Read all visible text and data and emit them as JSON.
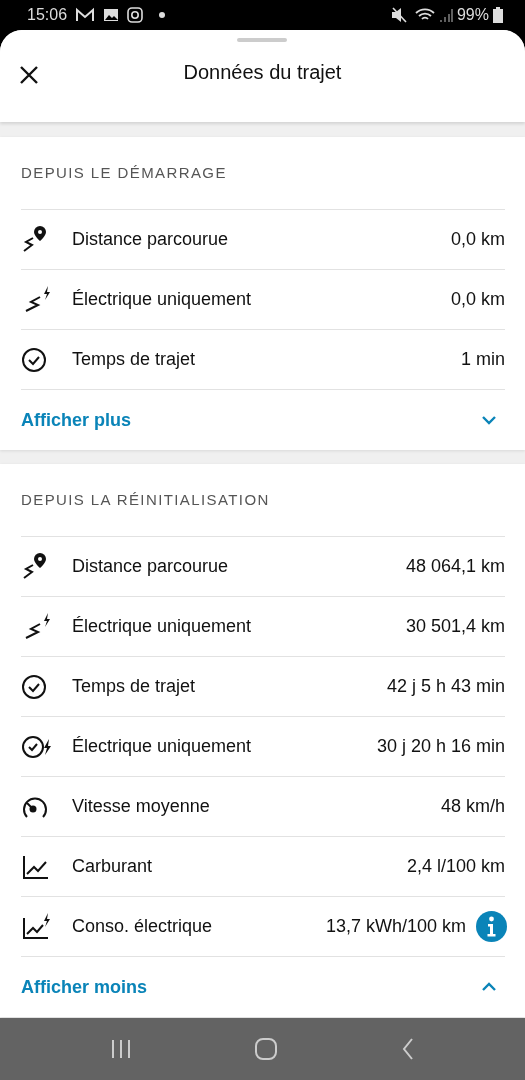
{
  "status_bar": {
    "time": "15:06",
    "battery": "99%"
  },
  "header": {
    "title": "Données du trajet"
  },
  "sections": [
    {
      "title": "DEPUIS LE DÉMARRAGE",
      "rows": [
        {
          "kind": "distance",
          "label": "Distance parcourue",
          "value": "0,0 km",
          "info": false
        },
        {
          "kind": "electric",
          "label": "Électrique uniquement",
          "value": "0,0 km",
          "info": false
        },
        {
          "kind": "clock",
          "label": "Temps de trajet",
          "value": "1 min",
          "info": false
        }
      ],
      "toggle": {
        "label": "Afficher plus",
        "expanded": false
      }
    },
    {
      "title": "DEPUIS LA RÉINITIALISATION",
      "rows": [
        {
          "kind": "distance",
          "label": "Distance parcourue",
          "value": "48 064,1 km",
          "info": false
        },
        {
          "kind": "electric",
          "label": "Électrique uniquement",
          "value": "30 501,4 km",
          "info": false
        },
        {
          "kind": "clock",
          "label": "Temps de trajet",
          "value": "42 j 5 h 43 min",
          "info": false
        },
        {
          "kind": "clockelectric",
          "label": "Électrique uniquement",
          "value": "30 j 20 h 16 min",
          "info": false
        },
        {
          "kind": "speedometer",
          "label": "Vitesse moyenne",
          "value": "48 km/h",
          "info": false
        },
        {
          "kind": "chart",
          "label": "Carburant",
          "value": "2,4 l/100 km",
          "info": false
        },
        {
          "kind": "chartelectric",
          "label": "Conso. électrique",
          "value": "13,7 kWh/100 km",
          "info": true
        }
      ],
      "toggle": {
        "label": "Afficher moins",
        "expanded": true
      }
    }
  ]
}
